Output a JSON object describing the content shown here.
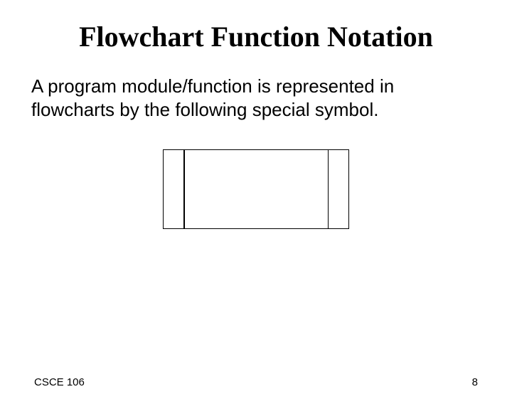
{
  "title": "Flowchart Function Notation",
  "body": "A program module/function is represented in flowcharts by the following special symbol.",
  "footer": {
    "left": "CSCE 106",
    "right": "8"
  }
}
